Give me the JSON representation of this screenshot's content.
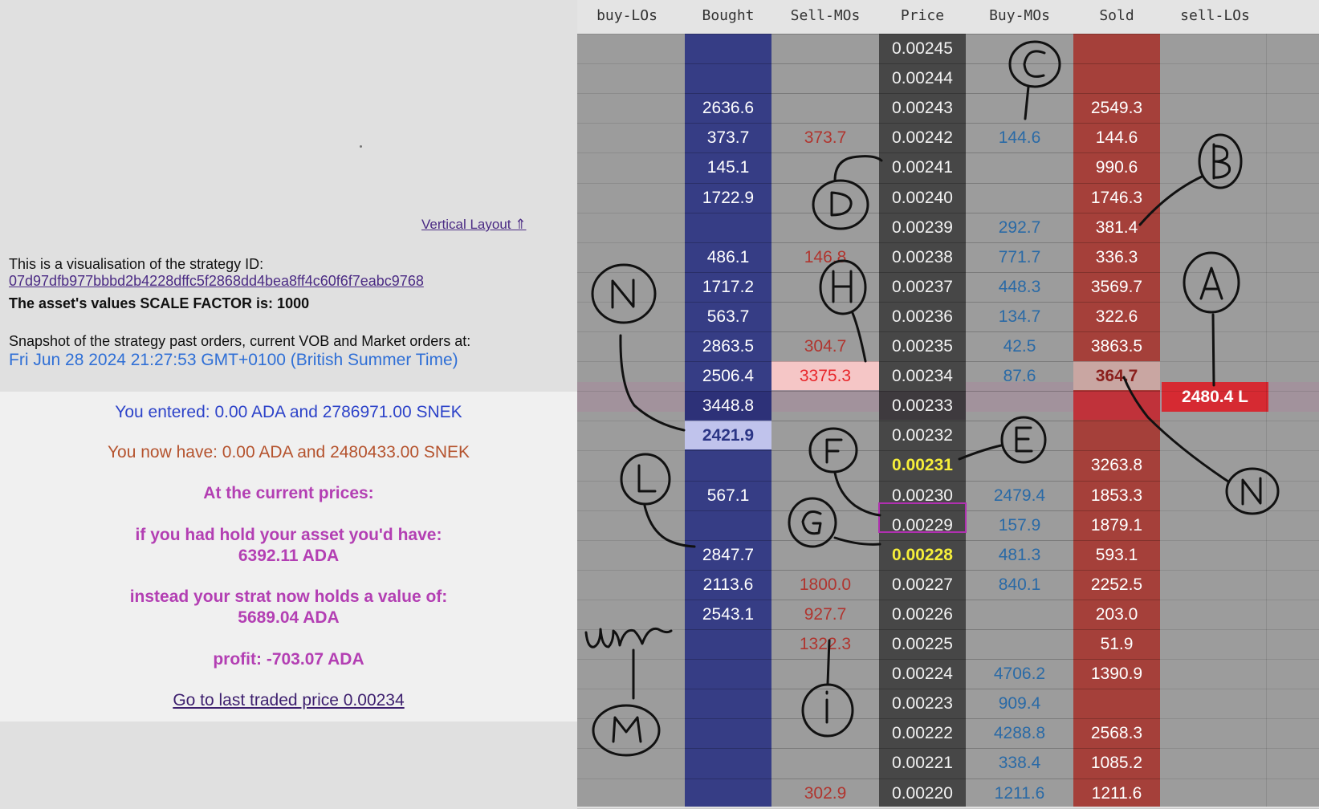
{
  "left": {
    "vertical_layout_link": "Vertical Layout ⇑",
    "intro": "This is a visualisation of the strategy ID:",
    "strategy_id": "07d97dfb977bbbd2b4228dffc5f2868dd4bea8ff4c60f6f7eabc9768",
    "scale_factor": "The asset's values SCALE FACTOR is: 1000",
    "snapshot_label": "Snapshot of the strategy past orders, current VOB and Market orders at:",
    "snapshot_date": "Fri Jun 28 2024 21:27:53 GMT+0100 (British Summer Time)",
    "entered": "You entered: 0.00 ADA and 2786971.00 SNEK",
    "now_have": "You now have: 0.00 ADA and 2480433.00 SNEK",
    "at_current": "At the current prices:",
    "hold_label": "if you had hold your asset you'd have:",
    "hold_value": "6392.11 ADA",
    "strat_label": "instead your strat now holds a value of:",
    "strat_value": "5689.04 ADA",
    "profit": "profit: -703.07 ADA",
    "last_price_link": "Go to last traded price 0.00234"
  },
  "book": {
    "headers": [
      "buy-LOs",
      "Bought",
      "Sell-MOs",
      "Price",
      "Buy-MOs",
      "Sold",
      "sell-LOs"
    ],
    "sell_lo_badge": "2480.4 L",
    "rows": [
      {
        "price": "0.00245",
        "bought": "",
        "sellmo": "",
        "buymo": "",
        "sold": ""
      },
      {
        "price": "0.00244",
        "bought": "",
        "sellmo": "",
        "buymo": "",
        "sold": ""
      },
      {
        "price": "0.00243",
        "bought": "2636.6",
        "sellmo": "",
        "buymo": "",
        "sold": "2549.3"
      },
      {
        "price": "0.00242",
        "bought": "373.7",
        "sellmo": "373.7",
        "buymo": "144.6",
        "sold": "144.6"
      },
      {
        "price": "0.00241",
        "bought": "145.1",
        "sellmo": "",
        "buymo": "",
        "sold": "990.6"
      },
      {
        "price": "0.00240",
        "bought": "1722.9",
        "sellmo": "",
        "buymo": "",
        "sold": "1746.3"
      },
      {
        "price": "0.00239",
        "bought": "",
        "sellmo": "",
        "buymo": "292.7",
        "sold": "381.4"
      },
      {
        "price": "0.00238",
        "bought": "486.1",
        "sellmo": "146.8",
        "buymo": "771.7",
        "sold": "336.3"
      },
      {
        "price": "0.00237",
        "bought": "1717.2",
        "sellmo": "",
        "buymo": "448.3",
        "sold": "3569.7"
      },
      {
        "price": "0.00236",
        "bought": "563.7",
        "sellmo": "",
        "buymo": "134.7",
        "sold": "322.6"
      },
      {
        "price": "0.00235",
        "bought": "2863.5",
        "sellmo": "304.7",
        "buymo": "42.5",
        "sold": "3863.5"
      },
      {
        "price": "0.00234",
        "bought": "2506.4",
        "sellmo": "3375.3",
        "buymo": "87.6",
        "sold": "364.7"
      },
      {
        "price": "0.00233",
        "bought": "3448.8",
        "sellmo": "",
        "buymo": "",
        "sold": ""
      },
      {
        "price": "0.00232",
        "bought": "2421.9",
        "sellmo": "",
        "buymo": "",
        "sold": ""
      },
      {
        "price": "0.00231",
        "bought": "",
        "sellmo": "",
        "buymo": "",
        "sold": "3263.8"
      },
      {
        "price": "0.00230",
        "bought": "567.1",
        "sellmo": "",
        "buymo": "2479.4",
        "sold": "1853.3"
      },
      {
        "price": "0.00229",
        "bought": "",
        "sellmo": "",
        "buymo": "157.9",
        "sold": "1879.1"
      },
      {
        "price": "0.00228",
        "bought": "2847.7",
        "sellmo": "",
        "buymo": "481.3",
        "sold": "593.1"
      },
      {
        "price": "0.00227",
        "bought": "2113.6",
        "sellmo": "1800.0",
        "buymo": "840.1",
        "sold": "2252.5"
      },
      {
        "price": "0.00226",
        "bought": "2543.1",
        "sellmo": "927.7",
        "buymo": "",
        "sold": "203.0"
      },
      {
        "price": "0.00225",
        "bought": "",
        "sellmo": "1322.3",
        "buymo": "",
        "sold": "51.9"
      },
      {
        "price": "0.00224",
        "bought": "",
        "sellmo": "",
        "buymo": "4706.2",
        "sold": "1390.9"
      },
      {
        "price": "0.00223",
        "bought": "",
        "sellmo": "",
        "buymo": "909.4",
        "sold": ""
      },
      {
        "price": "0.00222",
        "bought": "",
        "sellmo": "",
        "buymo": "4288.8",
        "sold": "2568.3"
      },
      {
        "price": "0.00221",
        "bought": "",
        "sellmo": "",
        "buymo": "338.4",
        "sold": "1085.2"
      },
      {
        "price": "0.00220",
        "bought": "",
        "sellmo": "302.9",
        "buymo": "1211.6",
        "sold": "1211.6"
      }
    ]
  },
  "annotations": [
    "A",
    "B",
    "C",
    "D",
    "E",
    "F",
    "G",
    "H",
    "I",
    "L",
    "M",
    "N",
    "N",
    "urr"
  ],
  "colors": {
    "bought_col": "#363d85",
    "sold_col": "#a5403a",
    "price_col": "#474747",
    "sell_lo_badge": "#d62a32",
    "highlight_price": "#f6ef3a"
  }
}
